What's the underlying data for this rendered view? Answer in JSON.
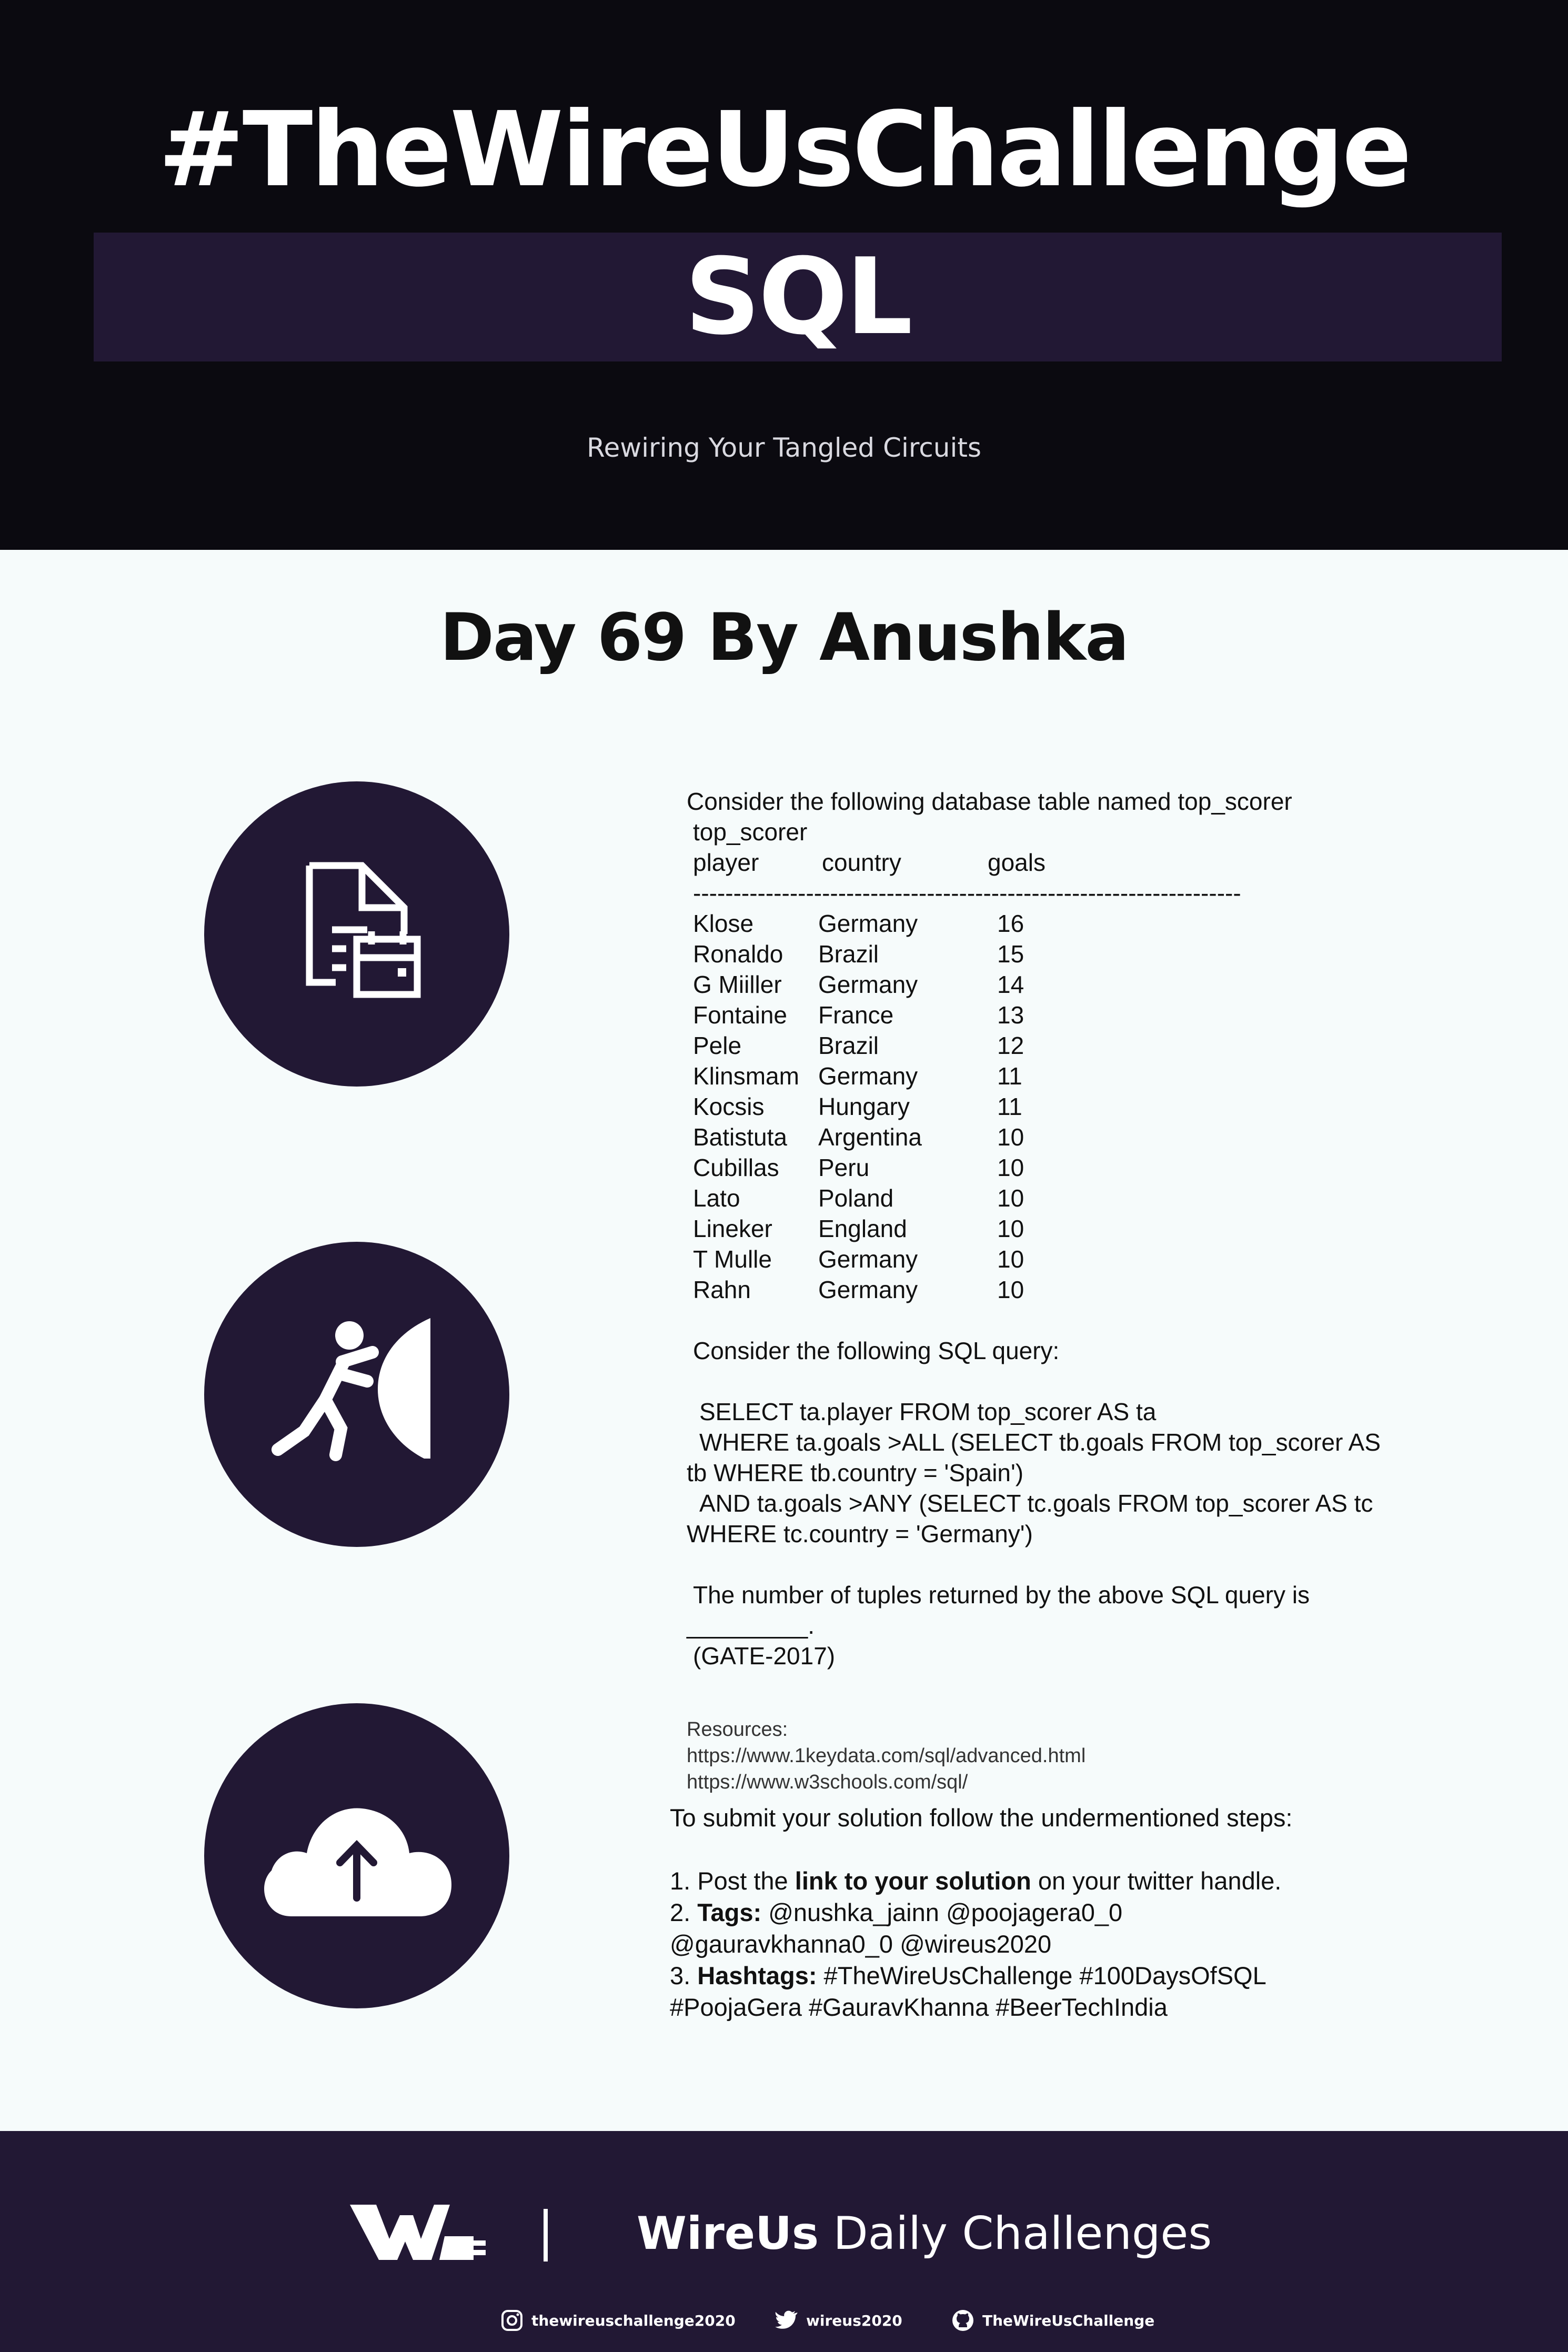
{
  "header": {
    "title": "#TheWireUsChallenge",
    "subject": "SQL",
    "tagline": "Rewiring Your Tangled Circuits"
  },
  "day_title": "Day 69 By Anushka",
  "icons": [
    "document-calendar-icon",
    "person-pushing-wall-icon",
    "cloud-upload-icon"
  ],
  "question": {
    "intro": "Consider the following database table named top_scorer",
    "table_name": "top_scorer",
    "columns": [
      "player",
      "country",
      "goals"
    ],
    "divider": "--------------------------------------------------------------------",
    "rows": [
      {
        "player": "Klose",
        "country": "Germany",
        "goals": "16"
      },
      {
        "player": "Ronaldo",
        "country": "Brazil",
        "goals": "15"
      },
      {
        "player": "G Miiller",
        "country": "Germany",
        "goals": "14"
      },
      {
        "player": "Fontaine",
        "country": "France",
        "goals": "13"
      },
      {
        "player": "Pele",
        "country": "Brazil",
        "goals": "12"
      },
      {
        "player": "Klinsmam",
        "country": "Germany",
        "goals": "11"
      },
      {
        "player": "Kocsis",
        "country": "Hungary",
        "goals": "11"
      },
      {
        "player": "Batistuta",
        "country": "Argentina",
        "goals": "10"
      },
      {
        "player": "Cubillas",
        "country": "Peru",
        "goals": "10"
      },
      {
        "player": "Lato",
        "country": "Poland",
        "goals": "10"
      },
      {
        "player": "Lineker",
        "country": "England",
        "goals": "10"
      },
      {
        "player": "T Mulle",
        "country": "Germany",
        "goals": "10"
      },
      {
        "player": "Rahn",
        "country": "Germany",
        "goals": "10"
      }
    ],
    "query_intro": "Consider the following SQL query:",
    "query_lines": [
      "SELECT ta.player FROM top_scorer AS ta",
      "WHERE ta.goals >ALL (SELECT tb.goals FROM top_scorer AS",
      "tb WHERE tb.country = 'Spain')",
      "AND ta.goals >ANY (SELECT tc.goals FROM top_scorer AS tc",
      "WHERE tc.country = 'Germany')"
    ],
    "ask_line1": "The number of tuples returned by the above SQL query is",
    "ask_line2": "_________.",
    "source": "(GATE-2017)"
  },
  "resources": {
    "label": "Resources:",
    "links": [
      "https://www.1keydata.com/sql/advanced.html",
      "https://www.w3schools.com/sql/"
    ]
  },
  "submit": {
    "intro": "To submit your solution follow the undermentioned steps:",
    "step1_prefix": "1. Post the ",
    "step1_bold": "link to your solution",
    "step1_suffix": " on your twitter handle.",
    "step2_prefix": "2. ",
    "step2_bold": "Tags:",
    "step2_rest": " @nushka_jainn @poojagera0_0",
    "step2_cont": "@gauravkhanna0_0 @wireus2020",
    "step3_prefix": "3. ",
    "step3_bold": "Hashtags:",
    "step3_rest": " #TheWireUsChallenge #100DaysOfSQL",
    "step3_cont": "#PoojaGera #GauravKhanna #BeerTechIndia"
  },
  "footer": {
    "brand_bold": "WireUs",
    "brand_rest": " Daily Challenges",
    "instagram": "thewireuschallenge2020",
    "twitter": "wireus2020",
    "github": "TheWireUsChallenge"
  }
}
